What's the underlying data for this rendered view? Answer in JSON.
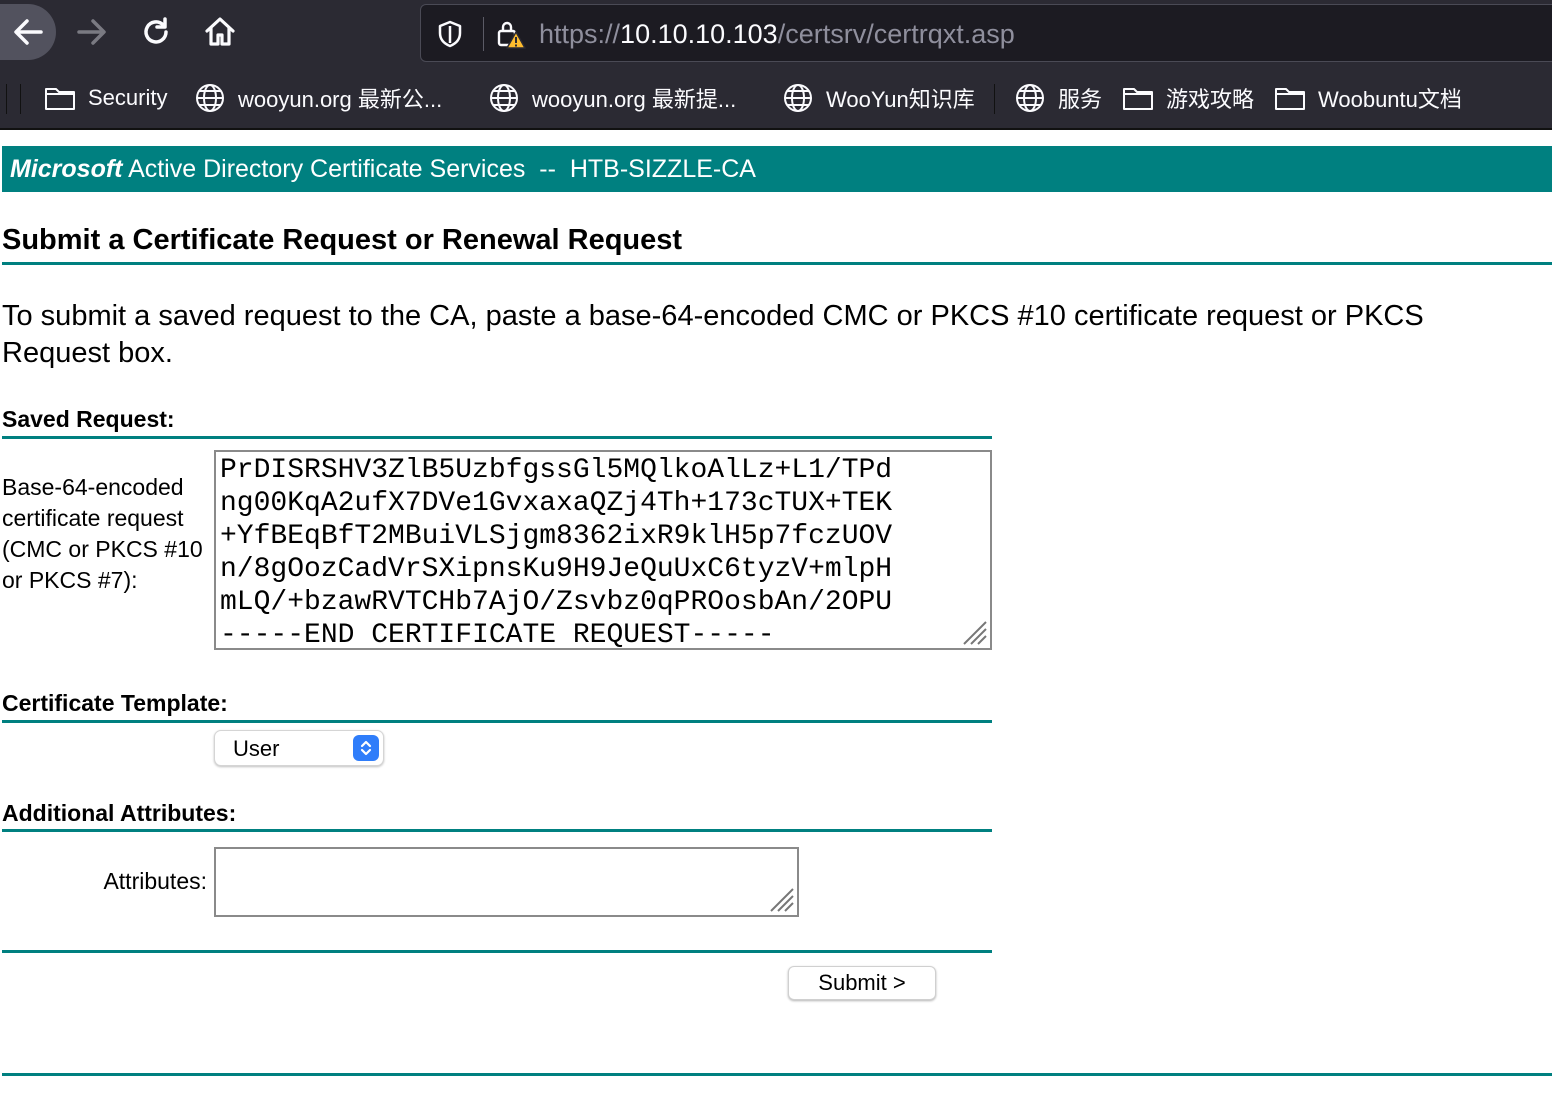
{
  "browser": {
    "url_scheme": "https://",
    "url_host": "10.10.10.103",
    "url_path": "/certsrv/certrqxt.asp",
    "bookmarks": [
      {
        "label": "Security",
        "icon": "folder-icon"
      },
      {
        "label": "wooyun.org 最新公...",
        "icon": "globe-icon"
      },
      {
        "label": "wooyun.org 最新提...",
        "icon": "globe-icon"
      },
      {
        "label": "WooYun知识库",
        "icon": "globe-icon"
      },
      {
        "label": "服务",
        "icon": "globe-icon"
      },
      {
        "label": "游戏攻略",
        "icon": "folder-icon"
      },
      {
        "label": "Woobuntu文档",
        "icon": "folder-icon"
      }
    ]
  },
  "page": {
    "banner_brand": "Microsoft",
    "banner_text": " Active Directory Certificate Services  --  HTB-SIZZLE-CA",
    "heading": "Submit a Certificate Request or Renewal Request",
    "intro_line1": "To submit a saved request to the CA, paste a base-64-encoded CMC or PKCS #10 certificate request or PKCS",
    "intro_line2": "Request box.",
    "saved_request_label": "Saved Request:",
    "request_field_label": "Base-64-encoded certificate request (CMC or PKCS #10 or PKCS #7):",
    "request_lines": [
      "PrDISRSHV3ZlB5UzbfgssGl5MQlkoAlLz+L1/TPd",
      "ng00KqA2ufX7DVe1GvxaxaQZj4Th+173cTUX+TEK",
      "+YfBEqBfT2MBuiVLSjgm8362ixR9klH5p7fczUOV",
      "n/8gOozCadVrSXipnsKu9H9JeQuUxC6tyzV+mlpH",
      "mLQ/+bzawRVTCHb7AjO/Zsvbz0qPROosbAn/2OPU",
      "-----END CERTIFICATE REQUEST-----"
    ],
    "template_label": "Certificate Template:",
    "template_value": "User",
    "additional_label": "Additional Attributes:",
    "attributes_label": "Attributes:",
    "attributes_value": "",
    "submit_label": "Submit >"
  },
  "colors": {
    "accent": "#008080",
    "chrome_bg": "#2b2a33",
    "select_arrow": "#2f7dfa"
  }
}
